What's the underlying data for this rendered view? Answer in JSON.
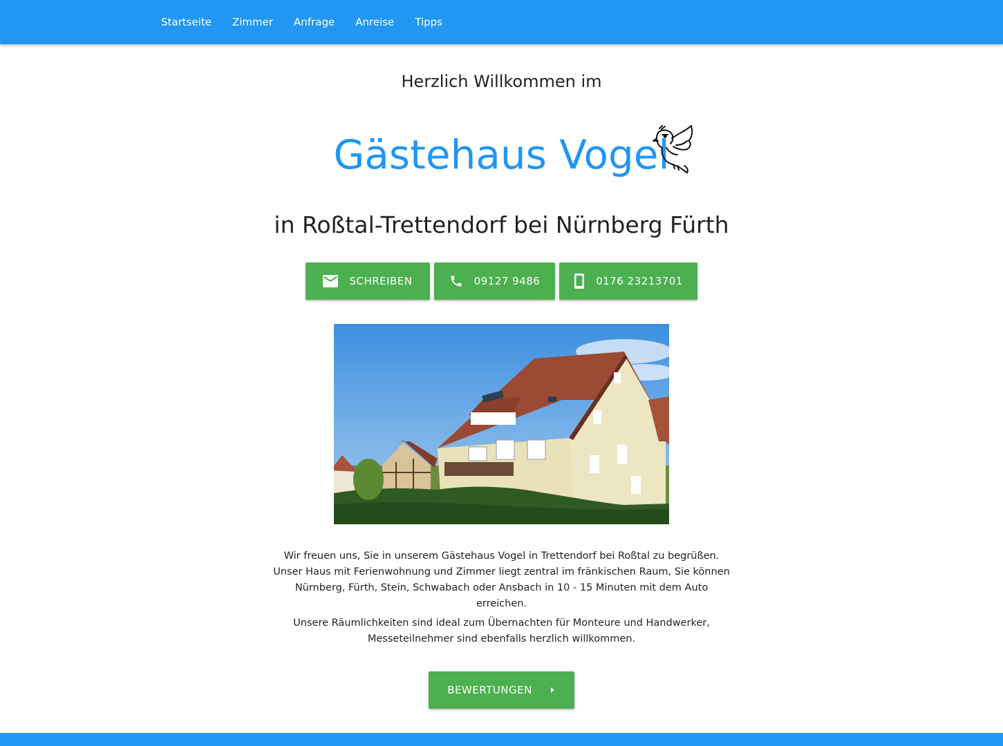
{
  "nav": {
    "items": [
      {
        "label": "Startseite"
      },
      {
        "label": "Zimmer"
      },
      {
        "label": "Anfrage"
      },
      {
        "label": "Anreise"
      },
      {
        "label": "Tipps"
      }
    ]
  },
  "hero": {
    "greeting": "Herzlich Willkommen im",
    "brand": "Gästehaus Vogel",
    "subtitle": "in Roßtal-Trettendorf bei Nürnberg Fürth"
  },
  "contact_buttons": {
    "write_label": "SCHREIBEN",
    "phone_label": "09127 9486",
    "mobile_label": "0176 23213701"
  },
  "intro": {
    "paragraph1": "Wir freuen uns, Sie in unserem Gästehaus Vogel in Trettendorf bei Roßtal zu begrüßen. Unser Haus mit Ferienwohnung und Zimmer liegt zentral im fränkischen Raum, Sie können Nürnberg, Fürth, Stein, Schwabach oder Ansbach in 10 - 15 Minuten mit dem Auto erreichen.",
    "paragraph2": "Unsere Räumlichkeiten sind ideal zum Übernachten für Monteure und Handwerker, Messeteilnehmer sind ebenfalls herzlich willkommen."
  },
  "reviews_button": {
    "label": "BEWERTUNGEN"
  },
  "colors": {
    "primary": "#2196f3",
    "button": "#4caf50"
  },
  "icons": [
    "email-icon",
    "phone-icon",
    "smartphone-icon",
    "chevron-right-icon",
    "bird-logo-icon"
  ]
}
